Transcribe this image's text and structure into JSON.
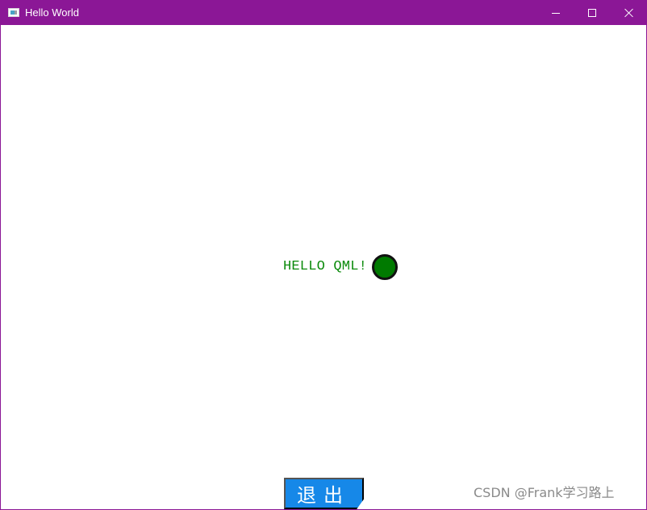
{
  "window": {
    "title": "Hello World",
    "colors": {
      "titlebar": "#8b1796",
      "content_background": "#ffffff"
    },
    "controls": {
      "minimize_icon": "minimize-icon",
      "maximize_icon": "maximize-icon",
      "close_icon": "close-icon"
    }
  },
  "content": {
    "hello_text": "HELLO QML!",
    "hello_text_color": "#0a8a0a",
    "status_circle": {
      "fill_color": "#007a00",
      "border_color": "#111111"
    },
    "exit_button": {
      "label": "退出",
      "color": "#1688e8"
    },
    "watermark": "CSDN @Frank学习路上"
  }
}
